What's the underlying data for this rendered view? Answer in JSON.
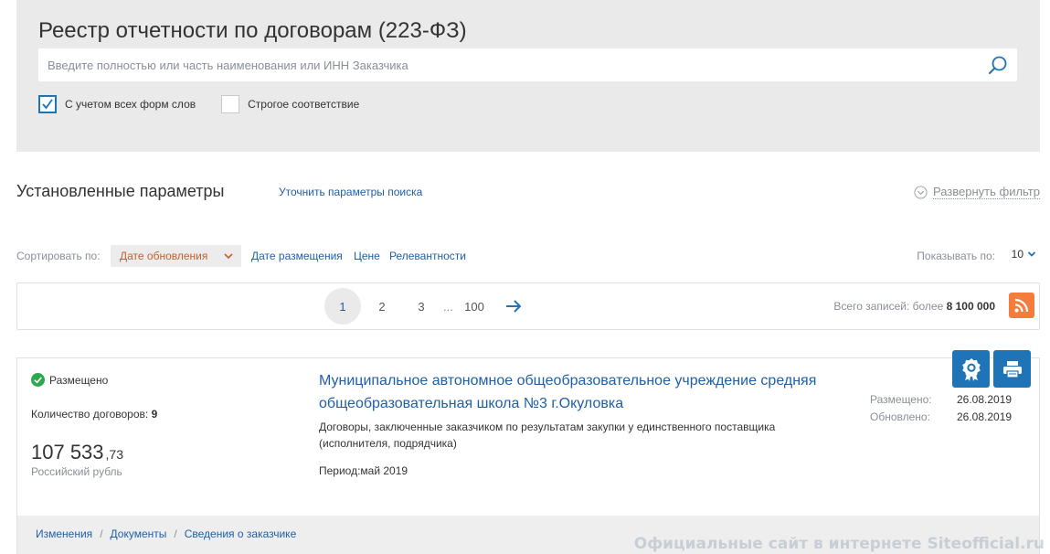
{
  "search": {
    "title": "Реестр отчетности по договорам (223-ФЗ)",
    "placeholder": "Введите полностью или часть наименования или ИНН Заказчика",
    "value": "",
    "options": [
      {
        "label": "С учетом всех форм слов",
        "checked": true
      },
      {
        "label": "Строгое соответствие",
        "checked": false
      }
    ]
  },
  "params": {
    "title": "Установленные параметры",
    "refine_label": "Уточнить параметры поиска",
    "expand_filter_label": "Развернуть фильтр"
  },
  "sort": {
    "label": "Сортировать по:",
    "selected": "Дате обновления",
    "options": [
      "Дате размещения",
      "Цене",
      "Релевантности"
    ],
    "show_label": "Показывать по:",
    "show_value": "10"
  },
  "pagination": {
    "pages": [
      "1",
      "2",
      "3"
    ],
    "ellipsis": "...",
    "last": "100",
    "total_label": "Всего записей: более",
    "total_value": "8 100 000"
  },
  "result": {
    "status": "Размещено",
    "contracts_label": "Количество договоров:",
    "contracts_value": "9",
    "amount_int": "107 533",
    "amount_frac": ",73",
    "currency": "Российский рубль",
    "title": "Муниципальное автономное общеобразовательное учреждение средняя общеобразовательная школа №3 г.Окуловка",
    "description": "Договоры, заключенные заказчиком по результатам закупки у единственного поставщика (исполнителя, подрядчика)",
    "period": "Период:май 2019",
    "placed_label": "Размещено:",
    "placed_date": "26.08.2019",
    "updated_label": "Обновлено:",
    "updated_date": "26.08.2019",
    "links": [
      "Изменения",
      "Документы",
      "Сведения о заказчике"
    ],
    "link_separator": "/"
  },
  "watermark": "Официальные сайт в интернете Siteofficial.ru",
  "colors": {
    "accent": "#1f73b7",
    "link": "#1f5fa6",
    "sort_selected": "#c0622e",
    "rss": "#f47c3c",
    "status_ok": "#2ea84f"
  },
  "icons": [
    "search-icon",
    "checkmark-icon",
    "circle-chevron-icon",
    "chevron-down-icon",
    "arrow-right-icon",
    "rss-icon",
    "check-circle-icon",
    "award-icon",
    "print-icon"
  ]
}
